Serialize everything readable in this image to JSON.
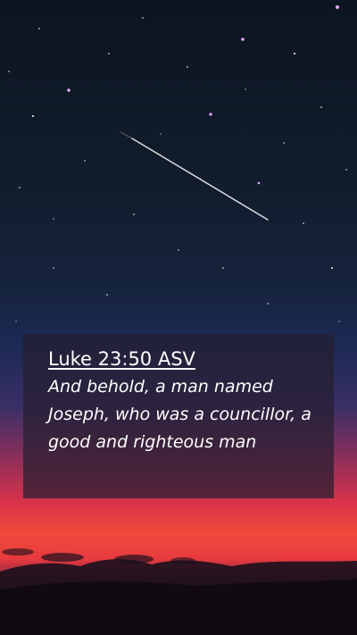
{
  "verse": {
    "reference": "Luke 23:50 ASV",
    "text": "And behold, a man named Joseph, who was a councillor, a good and righteous man"
  },
  "colors": {
    "sky_top": "#0d1a26",
    "sky_mid": "#1a2a4a",
    "horizon_purple": "#5a2d5e",
    "horizon_red": "#e03b4b",
    "horizon_orange": "#f05a3c",
    "card_background": "#261e30"
  }
}
